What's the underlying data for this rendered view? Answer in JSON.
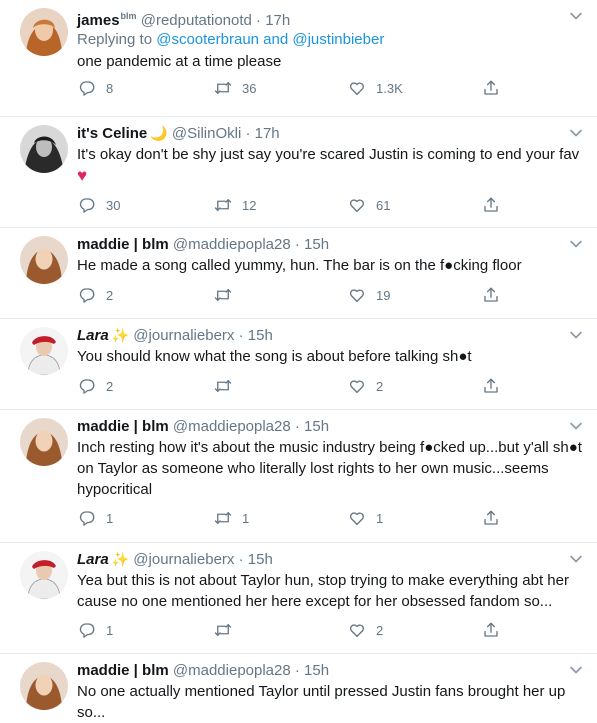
{
  "tweets": [
    {
      "name": "james",
      "name_sup": "blm",
      "handle": "@redputationotd",
      "time": "17h",
      "reply_prefix": "Replying to",
      "reply_user1": "@scooterbraun",
      "reply_and": "and",
      "reply_user2": "@justinbieber",
      "text": "one pandemic at a time please",
      "replies": "8",
      "retweets": "36",
      "likes": "1.3K"
    },
    {
      "name": "it's Celine",
      "emoji": "🌙",
      "handle": "@SilinOkli",
      "time": "17h",
      "text": "It's okay don't be shy just say you're scared Justin is coming to end your fav",
      "heart": "♥",
      "replies": "30",
      "retweets": "12",
      "likes": "61"
    },
    {
      "name": "maddie | blm",
      "handle": "@maddiepopla28",
      "time": "15h",
      "text": "He made a song called yummy, hun. The bar is on the f●cking floor",
      "replies": "2",
      "retweets": "",
      "likes": "19"
    },
    {
      "name": "Lara",
      "emoji": "✨",
      "handle": "@journalieberx",
      "time": "15h",
      "text": "You should know what the song is about before talking sh●t",
      "replies": "2",
      "retweets": "",
      "likes": "2"
    },
    {
      "name": "maddie | blm",
      "handle": "@maddiepopla28",
      "time": "15h",
      "text": "Inch resting how it's about the music industry being f●cked up...but y'all sh●t on Taylor as someone who literally lost rights to her own music...seems hypocritical",
      "replies": "1",
      "retweets": "1",
      "likes": "1"
    },
    {
      "name": "Lara",
      "emoji": "✨",
      "handle": "@journalieberx",
      "time": "15h",
      "text": "Yea but this is not about Taylor hun, stop trying to make everything abt her cause no one mentioned her here except for her obsessed fandom so...",
      "replies": "1",
      "retweets": "",
      "likes": "2"
    },
    {
      "name": "maddie | blm",
      "handle": "@maddiepopla28",
      "time": "15h",
      "text": "No one actually mentioned Taylor until pressed Justin fans brought her up so...",
      "replies": "",
      "retweets": "",
      "likes": ""
    }
  ],
  "dot": "·",
  "icons": [
    "reply-icon",
    "retweet-icon",
    "like-icon",
    "share-icon",
    "chevron-down-icon"
  ],
  "colors": {
    "link": "#1b95e0",
    "meta": "#657786",
    "heart": "#e0245e",
    "divider": "#e6ecf0"
  }
}
